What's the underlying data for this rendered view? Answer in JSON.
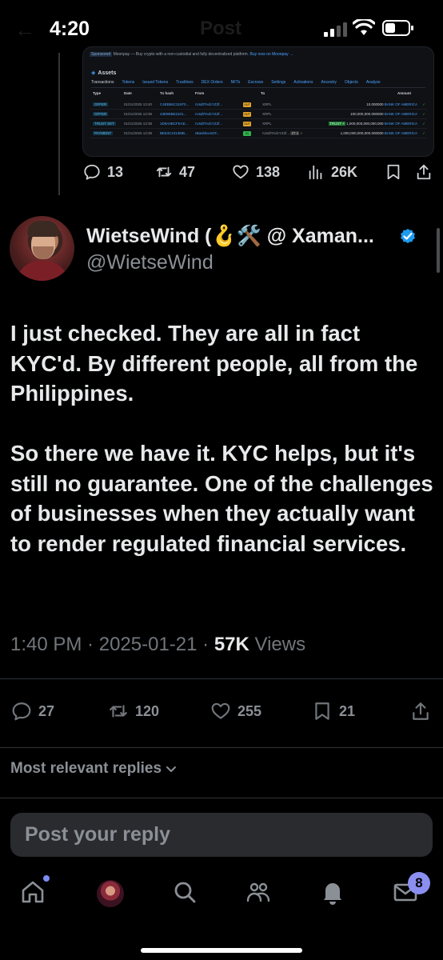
{
  "status_bar": {
    "time": "4:20",
    "ghost_title": "Post"
  },
  "embed": {
    "banner_tag": "Sponsored",
    "banner_text": "Moonpay — Buy crypto with a non-custodial and fully decentralized platform.",
    "banner_link": "Buy now on Moonpay →",
    "section_title": "Assets",
    "tabs": [
      "Transactions",
      "Tokens",
      "Issued Tokens",
      "Trustlines",
      "DEX Orders",
      "NFTs",
      "Escrows",
      "Settings",
      "Activations",
      "Ancestry",
      "Objects",
      "Analyze"
    ],
    "columns": {
      "type": "Type",
      "date": "Date",
      "hash": "Tx hash",
      "from": "From",
      "to": "To",
      "amount": "Amount"
    },
    "rows": [
      {
        "type": "OFFER",
        "date": "01/21/2025 13:40",
        "hash": "C4EB56C31970...",
        "from": "rUsdtTAdcYZ2f...",
        "dir": "OUT",
        "to": "XRPL",
        "amount": "10.000000",
        "currency": "BANK OF AMERICA"
      },
      {
        "type": "OFFER",
        "date": "01/21/2025 13:39",
        "hash": "43E9EBE2101...",
        "from": "rUsdtTAdcYZ2f...",
        "dir": "OUT",
        "to": "XRPL",
        "amount": "100,000,000.000000",
        "currency": "BANK OF AMERICA"
      },
      {
        "type": "TRUST SET",
        "date": "01/21/2025 13:38",
        "hash": "1D9A0BCFEAE...",
        "from": "rUsdtTAdcYZ2f...",
        "dir": "OUT",
        "to": "XRPL",
        "trust_label": "TRUST +",
        "amount": "1,000,000,000,000,000",
        "currency": "BANK OF AMERICA"
      },
      {
        "type": "PAYMENT",
        "date": "01/21/2025 13:38",
        "hash": "BE84C2413MB...",
        "from": "rBankkcesGF...",
        "dir": "IN",
        "to": "rUsdtTAdcYZ2f...",
        "to_extra": "27.1",
        "amount": "1,000,000,000,000.000000",
        "currency": "BANK OF AMERICA"
      }
    ]
  },
  "parent_actions": {
    "replies": "13",
    "reposts": "47",
    "likes": "138",
    "views": "26K"
  },
  "tweet": {
    "author_name": "WietseWind (🪝🛠️ @ Xaman...",
    "handle": "@WietseWind",
    "paragraphs": [
      "I just checked. They are all in fact KYC'd. By different people, all from the Philippines.",
      "So there we have it. KYC helps, but it's still no guarantee. One of the challenges of businesses when they actually want to render regulated financial services."
    ],
    "time": "1:40 PM",
    "date": "2025-01-21",
    "views_count": "57K",
    "views_label": "Views"
  },
  "tweet_actions": {
    "replies": "27",
    "reposts": "120",
    "likes": "255",
    "bookmarks": "21"
  },
  "replies_filter": "Most relevant replies",
  "reply_box": {
    "placeholder": "Post your reply"
  },
  "bottom_nav": {
    "messages_badge": "8"
  },
  "colors": {
    "background": "#000000",
    "text": "#e7e9ea",
    "muted": "#71767b",
    "verified": "#1d9bf0",
    "badge": "#8b8ff0"
  }
}
